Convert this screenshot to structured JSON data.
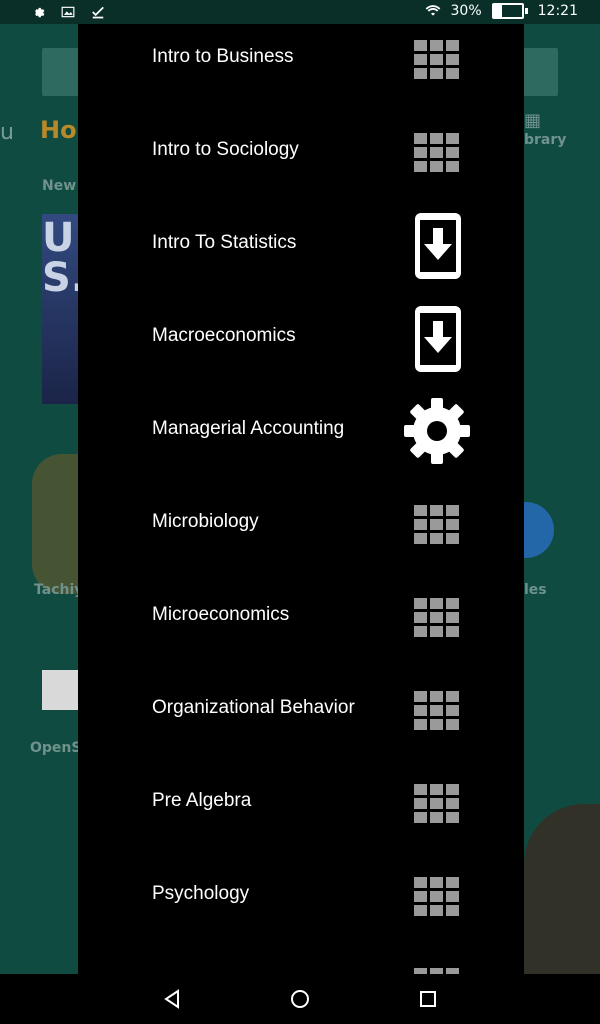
{
  "status_bar": {
    "battery_percent": "30%",
    "time": "12:21",
    "icons_left": [
      "settings-icon",
      "image-icon",
      "check-download-icon"
    ],
    "icons_right": [
      "wifi-icon",
      "battery-icon"
    ]
  },
  "background_app": {
    "section_home_partial": "Ho",
    "section_new_partial": "New",
    "library_label_partial": "brary",
    "left_partial": "u",
    "book_cover_text": "U. S.",
    "tile_label_1_partial": "Tachiy",
    "tile_label_2_partial": "les",
    "tile_label_3_partial": "OpenS"
  },
  "drawer": {
    "items": [
      {
        "label": "Intro to Business",
        "icon": "grid-icon"
      },
      {
        "label": "Intro to Sociology",
        "icon": "grid-icon"
      },
      {
        "label": "Intro To Statistics",
        "icon": "download-icon"
      },
      {
        "label": "Macroeconomics",
        "icon": "download-icon"
      },
      {
        "label": "Managerial Accounting",
        "icon": "gear-icon"
      },
      {
        "label": "Microbiology",
        "icon": "grid-icon"
      },
      {
        "label": "Microeconomics",
        "icon": "grid-icon"
      },
      {
        "label": "Organizational Behavior",
        "icon": "grid-icon"
      },
      {
        "label": "Pre Algebra",
        "icon": "grid-icon"
      },
      {
        "label": "Psychology",
        "icon": "grid-icon"
      }
    ]
  },
  "nav_bar": {
    "buttons": [
      "back-icon",
      "home-icon",
      "recents-icon"
    ]
  },
  "colors": {
    "drawer_bg": "#000000",
    "background_app": "#0f4b41",
    "accent_home": "#b8892a",
    "grid_icon": "#9a9a9a"
  }
}
